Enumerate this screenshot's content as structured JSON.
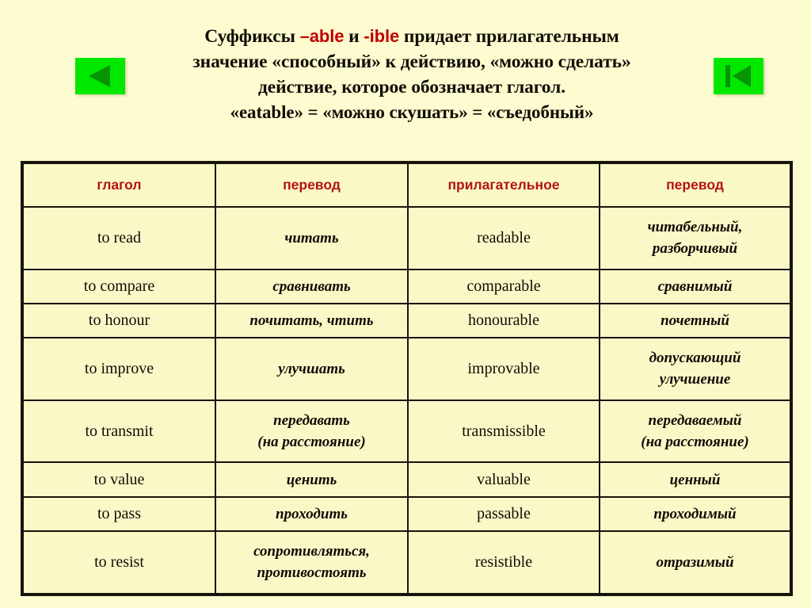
{
  "slide": {
    "background_color": "#fdfbd0",
    "title": {
      "line1_pre": "Суффиксы ",
      "line1_suffix_a": "–able",
      "line1_mid": " и ",
      "line1_suffix_b": "-ible",
      "line1_post": " придает прилагательным",
      "line2": "значение «способный» к действию, «можно сделать»",
      "line3": "действие, которое обозначает глагол.",
      "line4": "«eatable» = «можно скушать» = «съедобный»"
    },
    "nav": {
      "prev_label": "Назад",
      "first_label": "В начало",
      "button_color": "#00e800",
      "glyph_color": "#00a000"
    }
  },
  "table": {
    "accent_color": "#b31414",
    "cell_background": "#fbf8c8",
    "border_color": "#17140c",
    "headers": [
      "глагол",
      "перевод",
      "прилагательное",
      "перевод"
    ],
    "rows": [
      {
        "verb": "to read",
        "verb_ru": "читать",
        "adjective": "readable",
        "adjective_ru_1": "читабельный,",
        "adjective_ru_2": "разборчивый"
      },
      {
        "verb": "to compare",
        "verb_ru": "сравнивать",
        "adjective": "comparable",
        "adjective_ru_1": "сравнимый",
        "adjective_ru_2": ""
      },
      {
        "verb": "to honour",
        "verb_ru": "почитать, чтить",
        "adjective": "honourable",
        "adjective_ru_1": "почетный",
        "adjective_ru_2": ""
      },
      {
        "verb": "to improve",
        "verb_ru": "улучшать",
        "adjective": "improvable",
        "adjective_ru_1": "допускающий",
        "adjective_ru_2": "улучшение"
      },
      {
        "verb": "to transmit",
        "verb_ru": "передавать",
        "verb_ru_2": "(на расстояние)",
        "adjective": "transmissible",
        "adjective_ru_1": "передаваемый",
        "adjective_ru_2": "(на расстояние)"
      },
      {
        "verb": "to value",
        "verb_ru": "ценить",
        "adjective": "valuable",
        "adjective_ru_1": "ценный",
        "adjective_ru_2": ""
      },
      {
        "verb": "to pass",
        "verb_ru": "проходить",
        "adjective": "passable",
        "adjective_ru_1": "проходимый",
        "adjective_ru_2": ""
      },
      {
        "verb": "to resist",
        "verb_ru": "сопротивляться,",
        "verb_ru_2": "противостоять",
        "adjective": "resistible",
        "adjective_ru_1": "отразимый",
        "adjective_ru_2": ""
      }
    ]
  }
}
